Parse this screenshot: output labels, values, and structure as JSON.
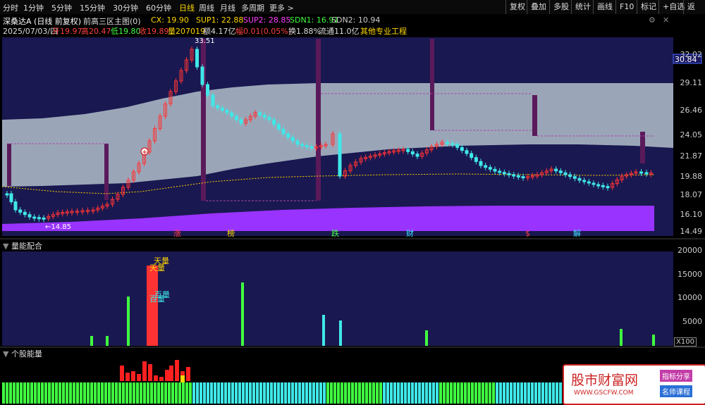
{
  "timeframes": [
    "分时",
    "1分钟",
    "5分钟",
    "15分钟",
    "30分钟",
    "60分钟",
    "日线",
    "周线",
    "月线",
    "多周期",
    "更多 >"
  ],
  "active_timeframe": "日线",
  "tools": [
    "复权",
    "叠加",
    "多股",
    "统计",
    "画线",
    "F10",
    "标记",
    "+自选",
    "返回"
  ],
  "header": {
    "title": "深桑达A (日线 前复权)",
    "indicator": "前高三区主图(0)",
    "cx": "CX: 19.90",
    "sup1": "SUP1: 22.88",
    "sup2": "SUP2: 28.85",
    "sdn1": "SDN1: 16.91",
    "sdn2": "SDN2: 10.94",
    "date": "2025/07/03/四",
    "open": "开19.97",
    "high": "高20.47",
    "low": "低19.80",
    "close": "收19.89",
    "vol": "量207019",
    "amt": "额4.17亿",
    "chg": "幅0.01(0.05%)",
    "turn": "换1.88%",
    "float": "流通11.0亿",
    "sector": "其他专业工程"
  },
  "price_axis": [
    "32.02",
    "29.11",
    "26.46",
    "24.05",
    "21.87",
    "19.88",
    "18.07",
    "16.10",
    "14.49"
  ],
  "current_price": "30.84",
  "high_label": "33.51",
  "low_label": "←14.85",
  "markers": [
    {
      "t": "涨",
      "c": "#ff4040"
    },
    {
      "t": "榜",
      "c": "#ffd700"
    },
    {
      "t": "跌",
      "c": "#40ff40"
    },
    {
      "t": "财",
      "c": "#40e0ff"
    },
    {
      "t": "$",
      "c": "#ff4040"
    },
    {
      "t": "解",
      "c": "#40e0ff"
    }
  ],
  "pane2": {
    "title": "量能配合",
    "axis": [
      "20000",
      "15000",
      "10000",
      "5000"
    ],
    "unit": "X100",
    "labels": [
      "天量",
      "百量"
    ]
  },
  "pane3": {
    "title": "个股能量"
  },
  "watermark": {
    "site": "股市财富网",
    "url": "WWW.GSCFW.COM",
    "tag1": "指标分享",
    "tag2": "名师课程"
  },
  "colors": {
    "up": "#ff3333",
    "down": "#40e8e8",
    "band": "#9aa6b8",
    "purple": "#9933ff",
    "dark_purple": "#5a1a5a"
  }
}
